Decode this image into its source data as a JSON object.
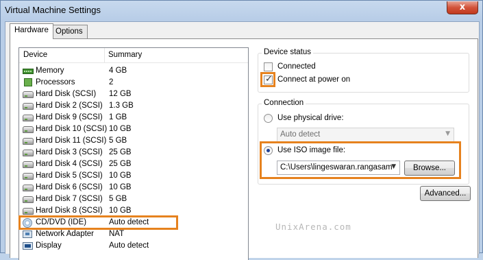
{
  "window": {
    "title": "Virtual Machine Settings",
    "close_glyph": "x"
  },
  "tabs": [
    {
      "label": "Hardware",
      "active": true
    },
    {
      "label": "Options",
      "active": false
    }
  ],
  "device_list": {
    "columns": [
      "Device",
      "Summary"
    ],
    "rows": [
      {
        "name": "Memory",
        "summary": "4 GB",
        "icon": "memory-icon"
      },
      {
        "name": "Processors",
        "summary": "2",
        "icon": "processor-icon"
      },
      {
        "name": "Hard Disk (SCSI)",
        "summary": "12 GB",
        "icon": "hard-disk-icon"
      },
      {
        "name": "Hard Disk 2 (SCSI)",
        "summary": "1.3 GB",
        "icon": "hard-disk-icon"
      },
      {
        "name": "Hard Disk 9 (SCSI)",
        "summary": "1 GB",
        "icon": "hard-disk-icon"
      },
      {
        "name": "Hard Disk 10 (SCSI)",
        "summary": "10 GB",
        "icon": "hard-disk-icon"
      },
      {
        "name": "Hard Disk 11 (SCSI)",
        "summary": "5 GB",
        "icon": "hard-disk-icon"
      },
      {
        "name": "Hard Disk 3 (SCSI)",
        "summary": "25 GB",
        "icon": "hard-disk-icon"
      },
      {
        "name": "Hard Disk 4 (SCSI)",
        "summary": "25 GB",
        "icon": "hard-disk-icon"
      },
      {
        "name": "Hard Disk 5 (SCSI)",
        "summary": "10 GB",
        "icon": "hard-disk-icon"
      },
      {
        "name": "Hard Disk 6 (SCSI)",
        "summary": "10 GB",
        "icon": "hard-disk-icon"
      },
      {
        "name": "Hard Disk 7 (SCSI)",
        "summary": "5 GB",
        "icon": "hard-disk-icon"
      },
      {
        "name": "Hard Disk 8 (SCSI)",
        "summary": "10 GB",
        "icon": "hard-disk-icon"
      },
      {
        "name": "CD/DVD (IDE)",
        "summary": "Auto detect",
        "icon": "cd-dvd-icon",
        "highlighted": true
      },
      {
        "name": "Network Adapter",
        "summary": "NAT",
        "icon": "network-adapter-icon"
      },
      {
        "name": "Display",
        "summary": "Auto detect",
        "icon": "display-icon"
      }
    ]
  },
  "device_status": {
    "title": "Device status",
    "connected": {
      "label": "Connected",
      "checked": false
    },
    "connect_at_power_on": {
      "label": "Connect at power on",
      "checked": true
    }
  },
  "connection": {
    "title": "Connection",
    "use_physical_drive": {
      "label": "Use physical drive:",
      "selected": false,
      "value": "Auto detect"
    },
    "use_iso_image": {
      "label": "Use ISO image file:",
      "selected": true,
      "value": "C:\\Users\\lingeswaran.rangasam"
    },
    "browse_label": "Browse...",
    "check_glyph": "✓",
    "dropdown_glyph": "▼"
  },
  "advanced_label": "Advanced...",
  "watermark": "UnixArena.com",
  "accent_color": "#e6821e"
}
